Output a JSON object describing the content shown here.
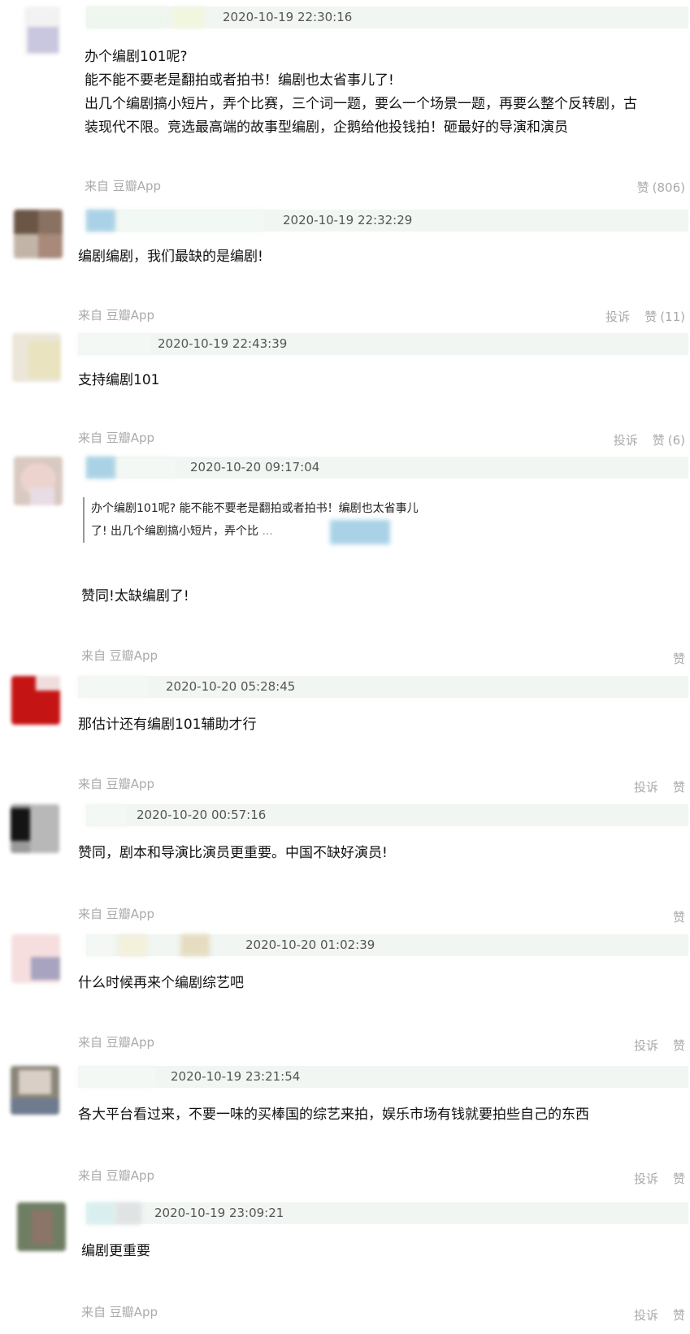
{
  "source_label": "来自 豆瓣App",
  "report_label": "投诉",
  "like_label": "赞",
  "comments": [
    {
      "time": "2020-10-19 22:30:16",
      "lines": [
        "办个编剧101呢?",
        "能不能不要老是翻拍或者拍书！编剧也太省事儿了!",
        "出几个编剧搞小短片，弄个比赛，三个词一题，要么一个场景一题，再要么整个反转剧，古",
        "装现代不限。竞选最高端的故事型编剧，企鹅给他投钱拍！砸最好的导演和演员"
      ],
      "like_count": "(806)"
    },
    {
      "time": "2020-10-19 22:32:29",
      "lines": [
        "编剧编剧，我们最缺的是编剧!"
      ],
      "like_count": "(11)"
    },
    {
      "time": "2020-10-19 22:43:39",
      "lines": [
        "支持编剧101"
      ],
      "like_count": "(6)"
    },
    {
      "time": "2020-10-20 09:17:04",
      "quote": [
        "办个编剧101呢?  能不能不要老是翻拍或者拍书！编剧也太省事儿",
        "了!  出几个编剧搞小短片，弄个比"
      ],
      "quote_ellipsis": "...",
      "lines": [
        "赞同!太缺编剧了!"
      ],
      "like_count": ""
    },
    {
      "time": "2020-10-20 05:28:45",
      "lines": [
        "那估计还有编剧101辅助才行"
      ],
      "like_count": ""
    },
    {
      "time": "2020-10-20 00:57:16",
      "lines": [
        "赞同，剧本和导演比演员更重要。中国不缺好演员!"
      ],
      "like_count": ""
    },
    {
      "time": "2020-10-20 01:02:39",
      "lines": [
        "什么时候再来个编剧综艺吧"
      ],
      "like_count": ""
    },
    {
      "time": "2020-10-19 23:21:54",
      "lines": [
        "各大平台看过来，不要一味的买棒国的综艺来拍，娱乐市场有钱就要拍些自己的东西"
      ],
      "like_count": ""
    },
    {
      "time": "2020-10-19 23:09:21",
      "lines": [
        "编剧更重要"
      ],
      "like_count": ""
    }
  ]
}
